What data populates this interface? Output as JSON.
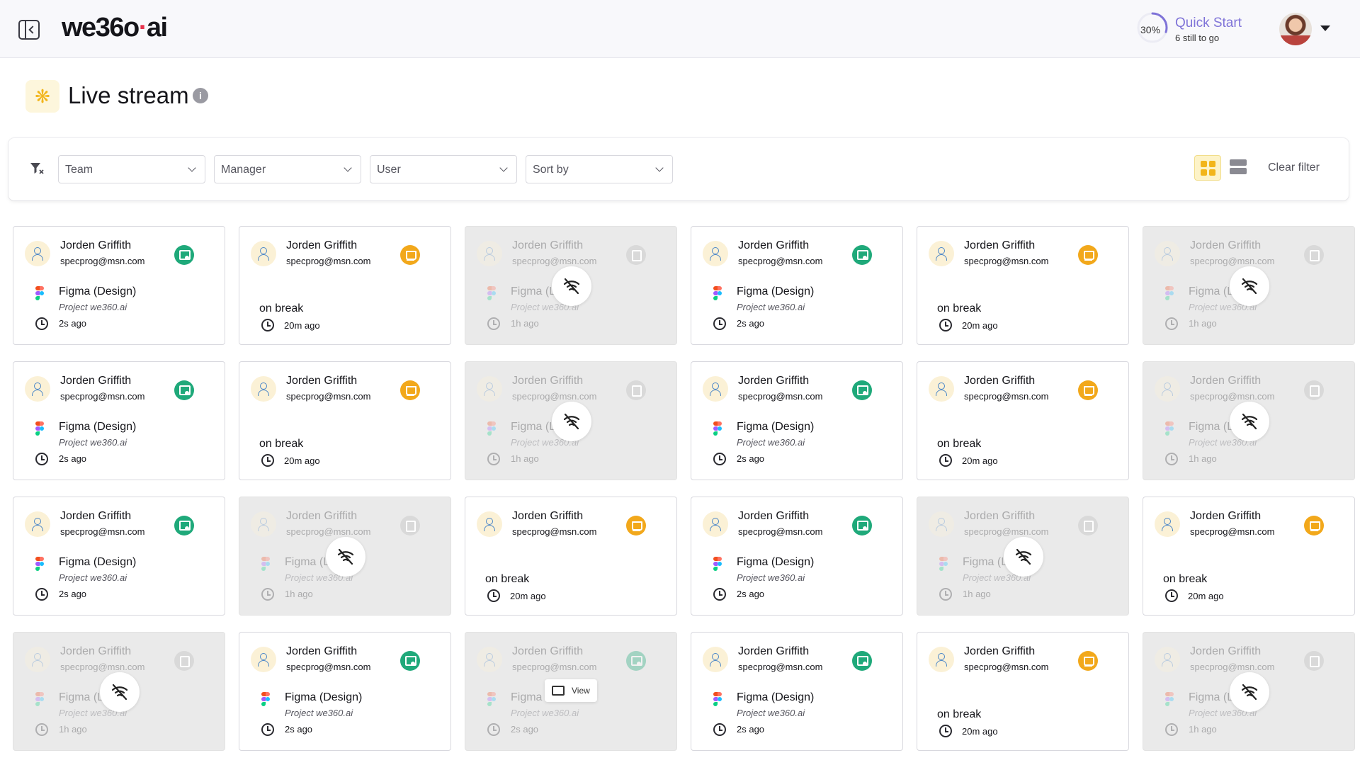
{
  "header": {
    "logo_main": "we36",
    "logo_mid": "o",
    "logo_dot": "·",
    "logo_tail": "ai",
    "quick_start": {
      "percent": "30%",
      "progress": 0.3,
      "title": "Quick Start",
      "subtitle": "6 still to go"
    },
    "icons": [
      "sidebar-toggle-icon",
      "profile-avatar",
      "chevron-down-icon"
    ]
  },
  "page": {
    "title": "Live stream",
    "info": "i"
  },
  "filters": {
    "team": "Team",
    "manager": "Manager",
    "user": "User",
    "sort_by": "Sort by",
    "clear": "Clear filter",
    "view_mode": "grid"
  },
  "colors": {
    "accent": "#f2b51b",
    "active": "#1fa97a",
    "break": "#f2a81b",
    "quick_start": "#7f73d8"
  },
  "cards": [
    {
      "state": "active",
      "name": "Jorden Griffith",
      "email": "specprog@msn.com",
      "app": "Figma (Design)",
      "project": "Project we360.ai",
      "time": "2s ago"
    },
    {
      "state": "break",
      "name": "Jorden Griffith",
      "email": "specprog@msn.com",
      "label": "on break",
      "time": "20m ago"
    },
    {
      "state": "offline",
      "name": "Jorden Griffith",
      "email": "specprog@msn.com",
      "app": "Figma (L",
      "project": "Project we360.ai",
      "time": "1h ago"
    },
    {
      "state": "active",
      "name": "Jorden Griffith",
      "email": "specprog@msn.com",
      "app": "Figma (Design)",
      "project": "Project we360.ai",
      "time": "2s ago"
    },
    {
      "state": "break",
      "name": "Jorden Griffith",
      "email": "specprog@msn.com",
      "label": "on break",
      "time": "20m ago"
    },
    {
      "state": "offline",
      "name": "Jorden Griffith",
      "email": "specprog@msn.com",
      "app": "Figma (L",
      "project": "Project we360.ai",
      "time": "1h ago"
    },
    {
      "state": "active",
      "name": "Jorden Griffith",
      "email": "specprog@msn.com",
      "app": "Figma (Design)",
      "project": "Project we360.ai",
      "time": "2s ago"
    },
    {
      "state": "break",
      "name": "Jorden Griffith",
      "email": "specprog@msn.com",
      "label": "on break",
      "time": "20m ago"
    },
    {
      "state": "offline",
      "name": "Jorden Griffith",
      "email": "specprog@msn.com",
      "app": "Figma (L",
      "project": "Project we360.ai",
      "time": "1h ago"
    },
    {
      "state": "active",
      "name": "Jorden Griffith",
      "email": "specprog@msn.com",
      "app": "Figma (Design)",
      "project": "Project we360.ai",
      "time": "2s ago"
    },
    {
      "state": "break",
      "name": "Jorden Griffith",
      "email": "specprog@msn.com",
      "label": "on break",
      "time": "20m ago"
    },
    {
      "state": "offline",
      "name": "Jorden Griffith",
      "email": "specprog@msn.com",
      "app": "Figma (L",
      "project": "Project we360.ai",
      "time": "1h ago"
    },
    {
      "state": "active",
      "name": "Jorden Griffith",
      "email": "specprog@msn.com",
      "app": "Figma (Design)",
      "project": "Project we360.ai",
      "time": "2s ago"
    },
    {
      "state": "offline",
      "name": "Jorden Griffith",
      "email": "specprog@msn.com",
      "app": "Figma (L",
      "project": "Project we360.ai",
      "time": "1h ago"
    },
    {
      "state": "break",
      "name": "Jorden Griffith",
      "email": "specprog@msn.com",
      "label": "on break",
      "time": "20m ago"
    },
    {
      "state": "active",
      "name": "Jorden Griffith",
      "email": "specprog@msn.com",
      "app": "Figma (Design)",
      "project": "Project we360.ai",
      "time": "2s ago"
    },
    {
      "state": "offline",
      "name": "Jorden Griffith",
      "email": "specprog@msn.com",
      "app": "Figma (L",
      "project": "Project we360.ai",
      "time": "1h ago"
    },
    {
      "state": "break",
      "name": "Jorden Griffith",
      "email": "specprog@msn.com",
      "label": "on break",
      "time": "20m ago"
    },
    {
      "state": "offline",
      "name": "Jorden Griffith",
      "email": "specprog@msn.com",
      "app": "Figma (L",
      "project": "Project we360.ai",
      "time": "1h ago"
    },
    {
      "state": "active",
      "name": "Jorden Griffith",
      "email": "specprog@msn.com",
      "app": "Figma (Design)",
      "project": "Project we360.ai",
      "time": "2s ago"
    },
    {
      "state": "hover",
      "name": "Jorden Griffith",
      "email": "specprog@msn.com",
      "app": "Figma",
      "project": "Project we360.ai",
      "time": "2s ago",
      "view": "View"
    },
    {
      "state": "active",
      "name": "Jorden Griffith",
      "email": "specprog@msn.com",
      "app": "Figma (Design)",
      "project": "Project we360.ai",
      "time": "2s ago"
    },
    {
      "state": "break",
      "name": "Jorden Griffith",
      "email": "specprog@msn.com",
      "label": "on break",
      "time": "20m ago"
    },
    {
      "state": "offline",
      "name": "Jorden Griffith",
      "email": "specprog@msn.com",
      "app": "Figma (L",
      "project": "Project we360.ai",
      "time": "1h ago"
    }
  ]
}
